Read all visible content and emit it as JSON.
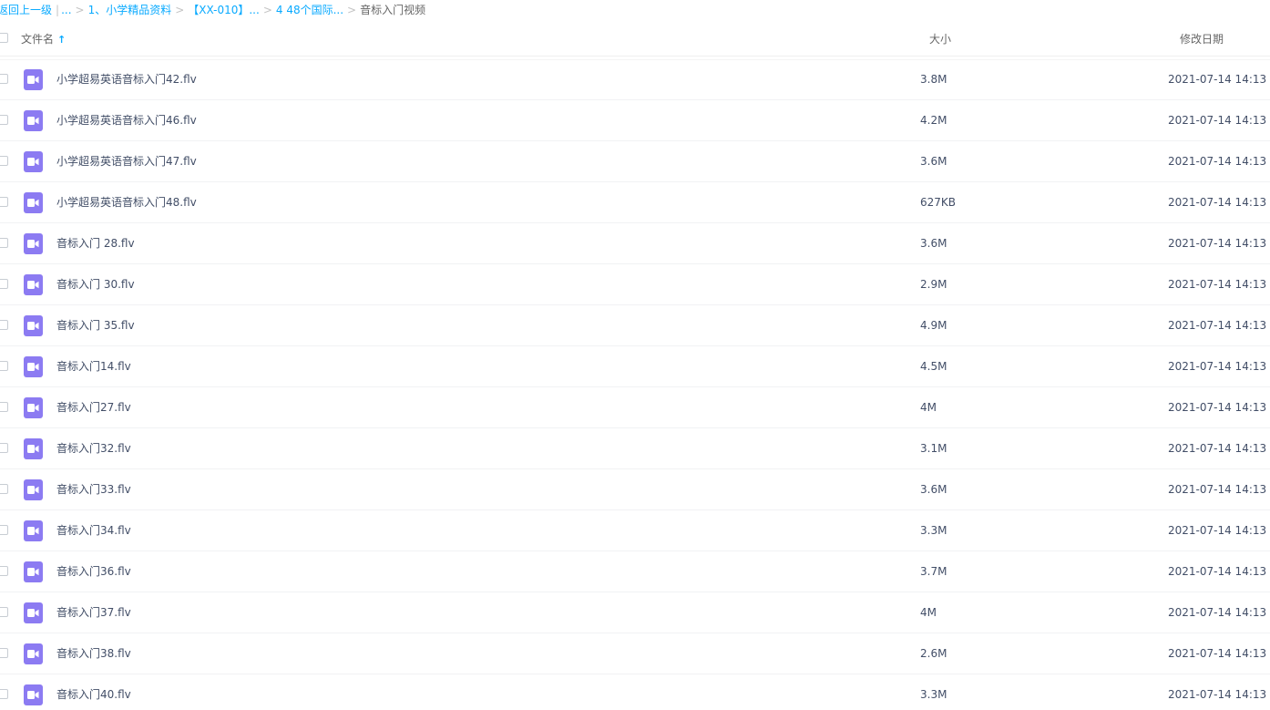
{
  "breadcrumb": {
    "back_label": "返回上一级",
    "ellipsis": "...",
    "items": [
      "1、小学精品资料",
      "【XX-010】...",
      "4 48个国际..."
    ],
    "current": "音标入门视频",
    "separator": ">",
    "pipe": "|"
  },
  "header": {
    "name_label": "文件名",
    "sort_icon": "↑",
    "size_label": "大小",
    "date_label": "修改日期"
  },
  "accent_color": "#09aaff",
  "icon_color": "#8c7bf2",
  "files": [
    {
      "name": "小学超易英语音标入门42.flv",
      "size": "3.8M",
      "date": "2021-07-14 14:13"
    },
    {
      "name": "小学超易英语音标入门46.flv",
      "size": "4.2M",
      "date": "2021-07-14 14:13"
    },
    {
      "name": "小学超易英语音标入门47.flv",
      "size": "3.6M",
      "date": "2021-07-14 14:13"
    },
    {
      "name": "小学超易英语音标入门48.flv",
      "size": "627KB",
      "date": "2021-07-14 14:13"
    },
    {
      "name": "音标入门 28.flv",
      "size": "3.6M",
      "date": "2021-07-14 14:13"
    },
    {
      "name": "音标入门 30.flv",
      "size": "2.9M",
      "date": "2021-07-14 14:13"
    },
    {
      "name": "音标入门 35.flv",
      "size": "4.9M",
      "date": "2021-07-14 14:13"
    },
    {
      "name": "音标入门14.flv",
      "size": "4.5M",
      "date": "2021-07-14 14:13"
    },
    {
      "name": "音标入门27.flv",
      "size": "4M",
      "date": "2021-07-14 14:13"
    },
    {
      "name": "音标入门32.flv",
      "size": "3.1M",
      "date": "2021-07-14 14:13"
    },
    {
      "name": "音标入门33.flv",
      "size": "3.6M",
      "date": "2021-07-14 14:13"
    },
    {
      "name": "音标入门34.flv",
      "size": "3.3M",
      "date": "2021-07-14 14:13"
    },
    {
      "name": "音标入门36.flv",
      "size": "3.7M",
      "date": "2021-07-14 14:13"
    },
    {
      "name": "音标入门37.flv",
      "size": "4M",
      "date": "2021-07-14 14:13"
    },
    {
      "name": "音标入门38.flv",
      "size": "2.6M",
      "date": "2021-07-14 14:13"
    },
    {
      "name": "音标入门40.flv",
      "size": "3.3M",
      "date": "2021-07-14 14:13"
    }
  ]
}
